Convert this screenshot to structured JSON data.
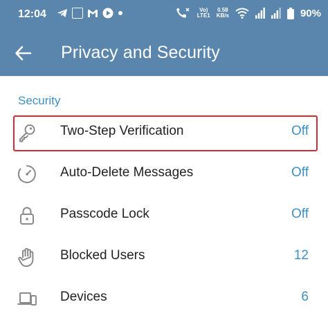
{
  "status_bar": {
    "time": "12:04",
    "network_vo": "Vo)",
    "network_lte": "LTE1",
    "speed_value": "0.58",
    "speed_unit": "KB/s",
    "battery": "90%"
  },
  "header": {
    "title": "Privacy and Security"
  },
  "section": {
    "title": "Security"
  },
  "rows": [
    {
      "label": "Two-Step Verification",
      "value": "Off",
      "icon": "key-icon"
    },
    {
      "label": "Auto-Delete Messages",
      "value": "Off",
      "icon": "timer-icon"
    },
    {
      "label": "Passcode Lock",
      "value": "Off",
      "icon": "lock-icon"
    },
    {
      "label": "Blocked Users",
      "value": "12",
      "icon": "hand-icon"
    },
    {
      "label": "Devices",
      "value": "6",
      "icon": "devices-icon"
    }
  ],
  "colors": {
    "header_bg": "#5a86ad",
    "accent": "#3d8fc4",
    "highlight": "#d62a33"
  }
}
